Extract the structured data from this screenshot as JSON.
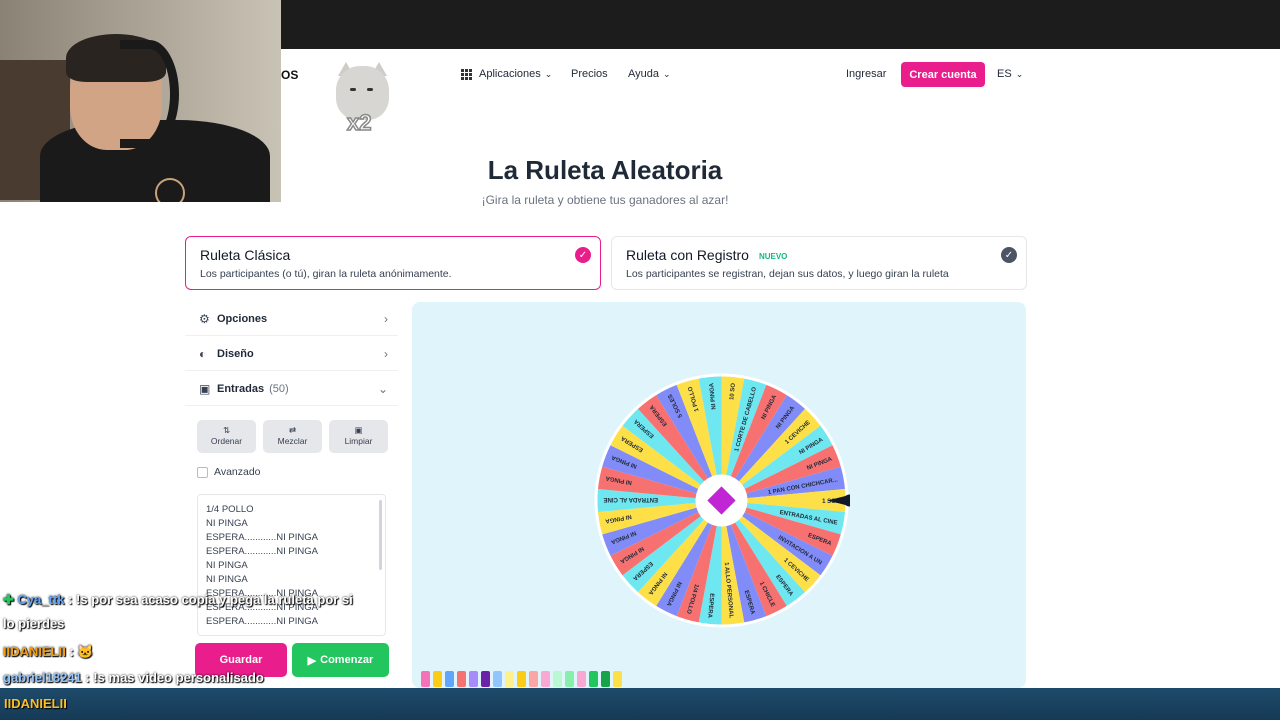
{
  "header": {
    "brand_tail": "OS",
    "cat_badge": "x2",
    "nav": {
      "apps": "Aplicaciones",
      "prices": "Precios",
      "help": "Ayuda"
    },
    "login": "Ingresar",
    "create": "Crear cuenta",
    "lang": "ES"
  },
  "hero": {
    "title": "La Ruleta Aleatoria",
    "subtitle": "¡Gira la ruleta y obtiene tus ganadores al azar!"
  },
  "modes": [
    {
      "title": "Ruleta Clásica",
      "desc": "Los participantes (o tú), giran la ruleta anónimamente.",
      "selected": true
    },
    {
      "title": "Ruleta con Registro",
      "badge": "NUEVO",
      "desc": "Los participantes se registran, dejan sus datos, y luego giran la ruleta",
      "selected": false
    }
  ],
  "panel": {
    "options": "Opciones",
    "design": "Diseño",
    "entries": "Entradas",
    "count": "(50)",
    "sort": "Ordenar",
    "shuffle": "Mezclar",
    "clear": "Limpiar",
    "advanced": "Avanzado",
    "entry_list": [
      "1/4 POLLO",
      "NI PINGA",
      "ESPERA............NI PINGA",
      "ESPERA............NI PINGA",
      "NI PINGA",
      "NI PINGA",
      "ESPERA............NI PINGA",
      "ESPERA............NI PINGA",
      "ESPERA............NI PINGA"
    ],
    "save": "Guardar",
    "start": "Comenzar"
  },
  "wheel": {
    "colors": [
      "#fde047",
      "#6ee7f0",
      "#f87171",
      "#818cf8"
    ],
    "labels": [
      "10 SO",
      "1 CORTE DE CABELLO",
      "NI PINGA",
      "NI PINGA",
      "1 CEVICHE",
      "NI PINGA",
      "NI PINGA",
      "1 PAN CON CHICHCAR...",
      "1 SOL",
      "ENTRADAS AL CINE",
      "ESPERA",
      "INVITACION A UN",
      "1 CEVICHE",
      "ESPERA",
      "1 CHICLE",
      "ESPERA",
      "1 ALLO PERSONAL",
      "ESPERA",
      "1/4 POLLO",
      "NI PINGA",
      "NI PINGA",
      "ESPERA",
      "NI PINGA",
      "NI PINGA",
      "NI PINGA",
      "ENTRADA AL CINE",
      "NI PINGA",
      "NI PINGA",
      "ESPERA",
      "ESPERA",
      "ESPERA",
      "5 SOLES",
      "1 POLLO",
      "NI PINGA"
    ]
  },
  "palette": [
    "#f472b6",
    "#facc15",
    "#60a5fa",
    "#f87171",
    "#a78bfa",
    "#6b21a8",
    "#93c5fd",
    "#fef08a",
    "#facc15",
    "#fca5a5",
    "#f9a8d4",
    "#bbf7d0",
    "#86efac",
    "#f9a8d4",
    "#22c55e",
    "#16a34a",
    "#fde047"
  ],
  "chat": [
    {
      "user": "Cya_ttk",
      "msg": " : !s por sea acaso copia y pega la ruleta por si"
    },
    {
      "user": "",
      "msg": "lo pierdes"
    },
    {
      "user": "IIDANIELII",
      "msg": " : "
    },
    {
      "user": "gabriel18241",
      "msg": " : !s mas video personalisado"
    }
  ],
  "taskbar": {
    "label": "IIDANIELII"
  }
}
